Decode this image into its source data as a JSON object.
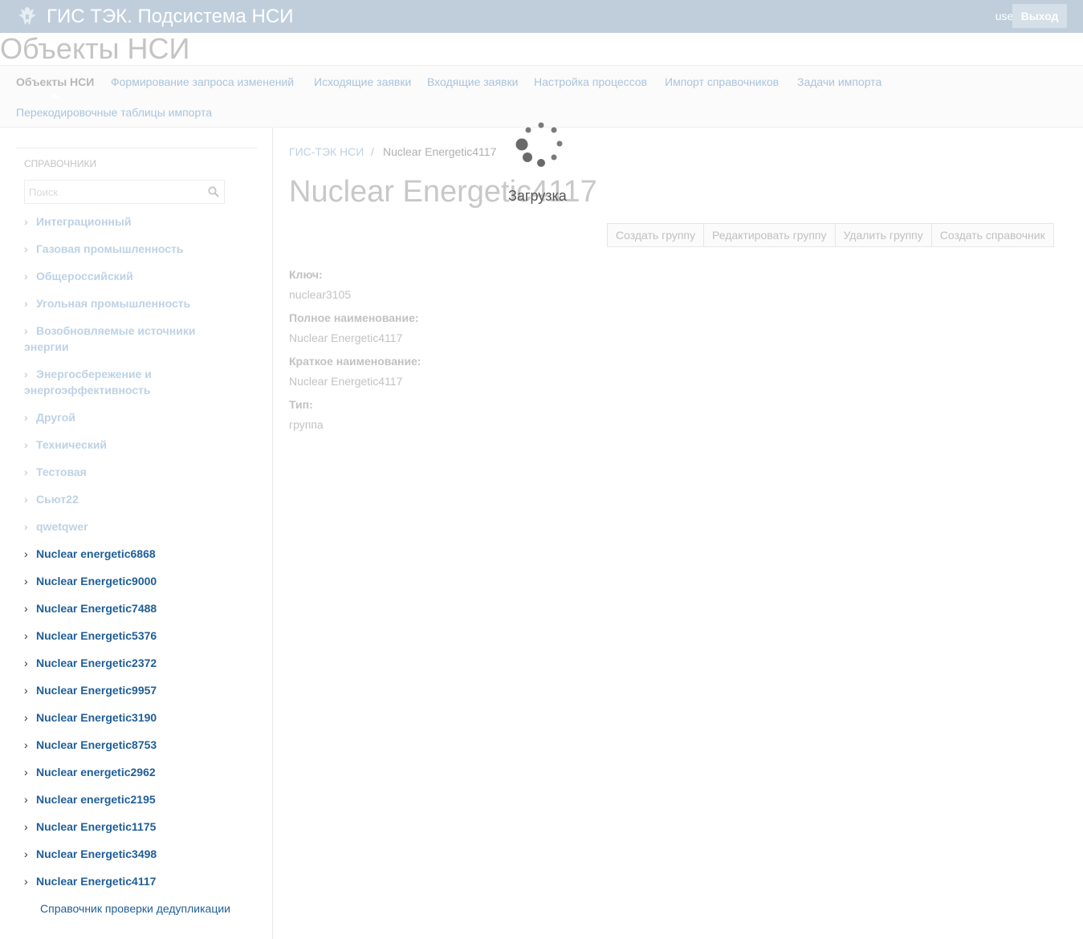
{
  "header": {
    "logo_icon": "emblem-icon",
    "title": "ГИС ТЭК. Подсистема НСИ",
    "user": "user",
    "logout_label": "Выход"
  },
  "page_title": "Объекты НСИ",
  "nav": {
    "items": [
      {
        "label": "Объекты НСИ",
        "active": true
      },
      {
        "label": "Формирование запроса изменений"
      },
      {
        "label": "Исходящие заявки"
      },
      {
        "label": "Входящие заявки"
      },
      {
        "label": "Настройка процессов"
      },
      {
        "label": "Импорт справочников"
      },
      {
        "label": "Задачи импорта"
      },
      {
        "label": "Перекодировочные таблицы импорта"
      }
    ]
  },
  "sidebar": {
    "heading": "СПРАВОЧНИКИ",
    "search_placeholder": "Поиск",
    "tree": [
      {
        "label": "Интеграционный"
      },
      {
        "label": "Газовая промышленность"
      },
      {
        "label": "Общероссийский"
      },
      {
        "label": "Угольная промышленность"
      },
      {
        "label": "Возобновляемые источники энергии"
      },
      {
        "label": "Энергосбережение и энергоэффективность"
      },
      {
        "label": "Другой"
      },
      {
        "label": "Технический"
      },
      {
        "label": "Тестовая"
      },
      {
        "label": "Сьют22"
      },
      {
        "label": "qwetqwer"
      },
      {
        "label": "Nuclear energetic6868"
      },
      {
        "label": "Nuclear Energetic9000"
      },
      {
        "label": "Nuclear Energetic7488"
      },
      {
        "label": "Nuclear Energetic5376"
      },
      {
        "label": "Nuclear Energetic2372"
      },
      {
        "label": "Nuclear Energetic9957"
      },
      {
        "label": "Nuclear Energetic3190"
      },
      {
        "label": "Nuclear Energetic8753"
      },
      {
        "label": "Nuclear energetic2962"
      },
      {
        "label": "Nuclear energetic2195"
      },
      {
        "label": "Nuclear Energetic1175"
      },
      {
        "label": "Nuclear Energetic3498"
      },
      {
        "label": "Nuclear Energetic4117"
      }
    ],
    "leaf": "Справочник проверки дедупликации"
  },
  "breadcrumb": {
    "home": "ГИС-ТЭК НСИ",
    "separator": "/",
    "current": "Nuclear Energetic4117"
  },
  "main": {
    "title": "Nuclear Energetic4117",
    "buttons": [
      "Создать группу",
      "Редактировать группу",
      "Удалить группу",
      "Создать справочник"
    ],
    "fields": [
      {
        "label": "Ключ:",
        "value": "nuclear3105"
      },
      {
        "label": "Полное наименование:",
        "value": "Nuclear Energetic4117"
      },
      {
        "label": "Краткое наименование:",
        "value": "Nuclear Energetic4117"
      },
      {
        "label": "Тип:",
        "value": "группа"
      }
    ]
  },
  "loading": {
    "text": "Загрузка",
    "icon": "spinner-icon"
  }
}
